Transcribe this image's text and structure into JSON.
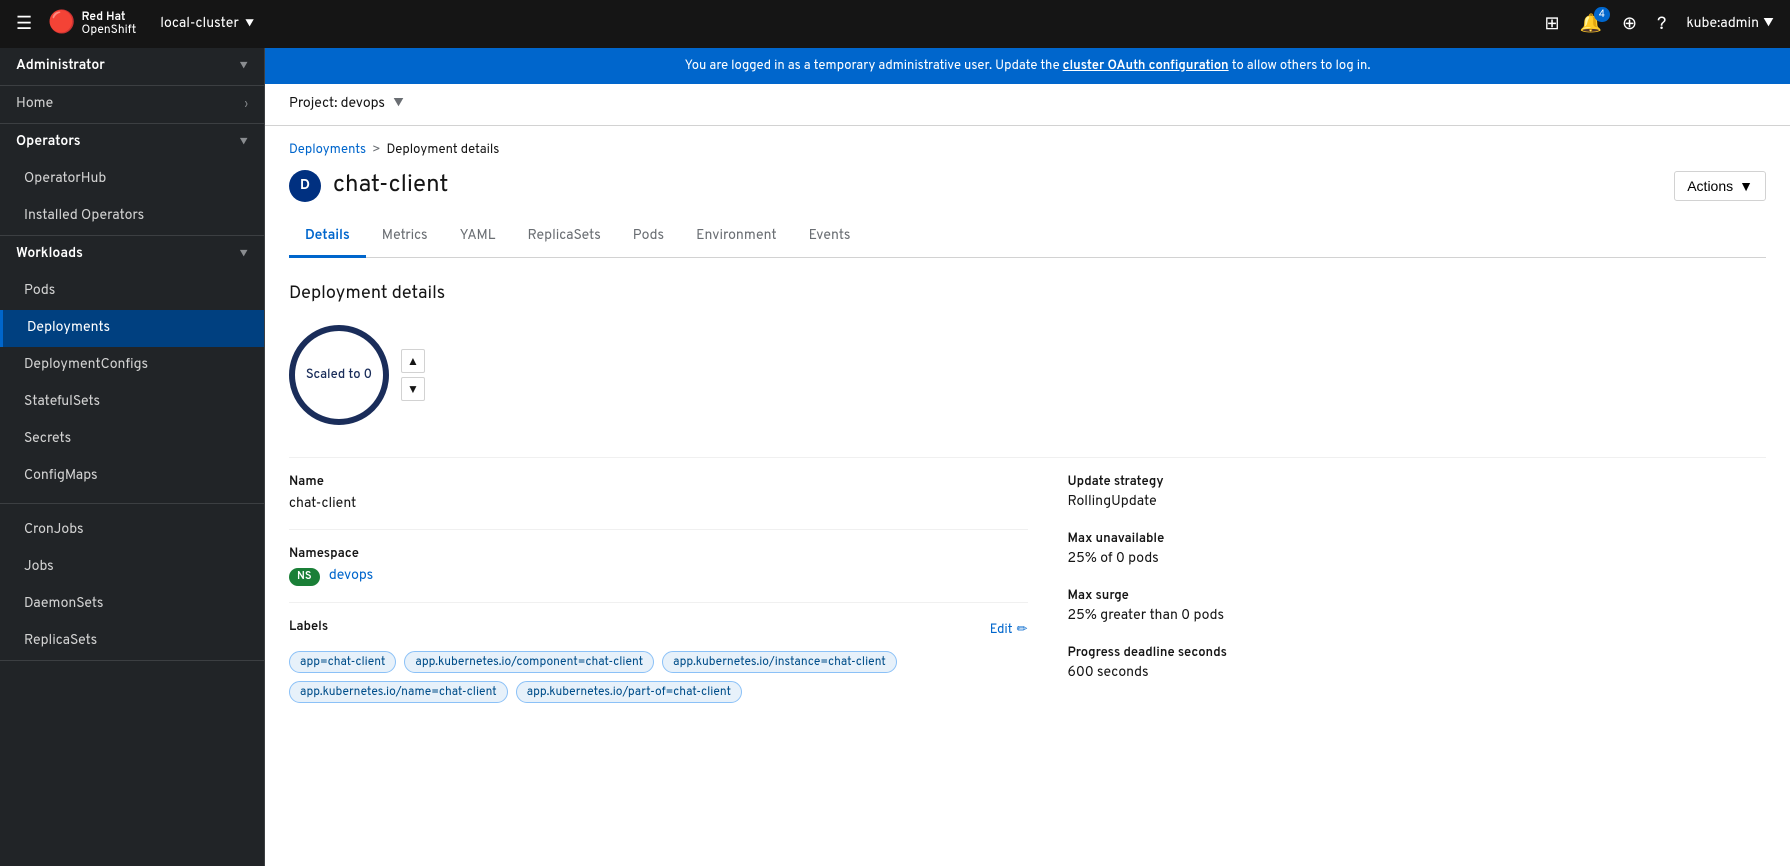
{
  "navbar": {
    "hamburger_label": "☰",
    "brand_red_hat": "Red Hat",
    "brand_openshift": "OpenShift",
    "cluster_name": "local-cluster",
    "notification_count": "4",
    "user": "kube:admin"
  },
  "banner": {
    "text": "You are logged in as a temporary administrative user. Update the ",
    "link_text": "cluster OAuth configuration",
    "text_suffix": " to allow others to log in."
  },
  "project": {
    "label": "Project: devops"
  },
  "breadcrumb": {
    "parent": "Deployments",
    "separator": ">",
    "current": "Deployment details"
  },
  "page_title": "chat-client",
  "deployment_icon": "D",
  "actions_label": "Actions",
  "tabs": [
    {
      "id": "details",
      "label": "Details",
      "active": true
    },
    {
      "id": "metrics",
      "label": "Metrics",
      "active": false
    },
    {
      "id": "yaml",
      "label": "YAML",
      "active": false
    },
    {
      "id": "replicasets",
      "label": "ReplicaSets",
      "active": false
    },
    {
      "id": "pods",
      "label": "Pods",
      "active": false
    },
    {
      "id": "environment",
      "label": "Environment",
      "active": false
    },
    {
      "id": "events",
      "label": "Events",
      "active": false
    }
  ],
  "deployment_details": {
    "section_title": "Deployment details",
    "replica_text": "Scaled to 0",
    "name_label": "Name",
    "name_value": "chat-client",
    "namespace_label": "Namespace",
    "namespace_badge": "NS",
    "namespace_value": "devops",
    "labels_label": "Labels",
    "edit_label": "Edit",
    "labels": [
      "app=chat-client",
      "app.kubernetes.io/component=chat-client",
      "app.kubernetes.io/instance=chat-client",
      "app.kubernetes.io/name=chat-client",
      "app.kubernetes.io/part-of=chat-client"
    ],
    "update_strategy_label": "Update strategy",
    "update_strategy_value": "RollingUpdate",
    "max_unavailable_label": "Max unavailable",
    "max_unavailable_value": "25% of 0 pods",
    "max_surge_label": "Max surge",
    "max_surge_value": "25% greater than 0 pods",
    "progress_deadline_label": "Progress deadline seconds",
    "progress_deadline_value": "600 seconds"
  },
  "sidebar": {
    "admin_label": "Administrator",
    "home_label": "Home",
    "operators_label": "Operators",
    "operator_hub_label": "OperatorHub",
    "installed_operators_label": "Installed Operators",
    "workloads_label": "Workloads",
    "pods_label": "Pods",
    "deployments_label": "Deployments",
    "deployment_configs_label": "DeploymentConfigs",
    "stateful_sets_label": "StatefulSets",
    "secrets_label": "Secrets",
    "config_maps_label": "ConfigMaps",
    "cron_jobs_label": "CronJobs",
    "jobs_label": "Jobs",
    "daemon_sets_label": "DaemonSets",
    "replica_sets_label": "ReplicaSets"
  }
}
